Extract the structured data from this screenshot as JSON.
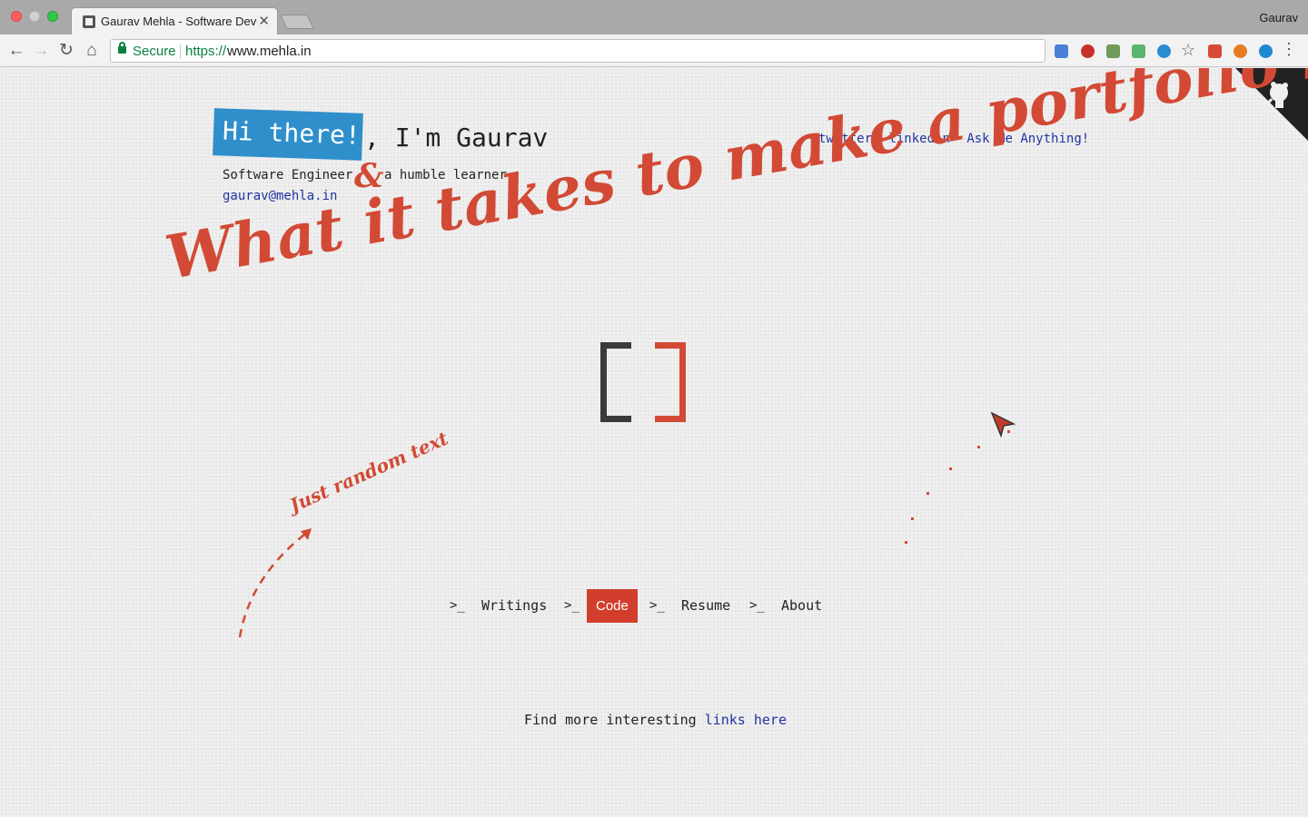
{
  "browser": {
    "tab_title": "Gaurav Mehla - Software Deve",
    "profile": "Gaurav",
    "secure_label": "Secure",
    "url_scheme": "https://",
    "url_host": "www.mehla.in"
  },
  "header": {
    "greeting_badge": "Hi there!",
    "greeting_rest": ", I'm Gaurav",
    "role": "Software Engineer",
    "ampersand": "&",
    "tagline": "a humble learner",
    "email": "gaurav@mehla.in"
  },
  "social_links": [
    "twitter",
    "linkedin",
    "Ask Me Anything!"
  ],
  "headline": "What it takes to make a portfolio like this ?",
  "random_note": "Just random text",
  "nav": {
    "prompt": ">_",
    "items": [
      "Writings",
      "Code",
      "Resume",
      "About"
    ],
    "active": "Code"
  },
  "footer": {
    "text": "Find more interesting",
    "link": "links here"
  },
  "colors": {
    "accent_red": "#d24a35",
    "badge_blue": "#2f8fcb",
    "link_blue": "#1f35a3"
  }
}
